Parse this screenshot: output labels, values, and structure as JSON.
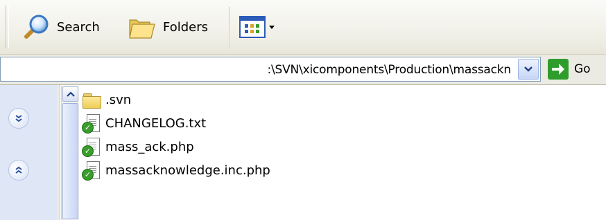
{
  "toolbar": {
    "search_label": "Search",
    "folders_label": "Folders",
    "search_icon": "search-icon",
    "folders_icon": "folders-icon",
    "views_icon": "views-icon"
  },
  "address": {
    "path": ":\\SVN\\xicomponents\\Production\\massackn",
    "go_label": "Go"
  },
  "files": [
    {
      "name": ".svn",
      "type": "folder"
    },
    {
      "name": "CHANGELOG.txt",
      "type": "file-svn-ok"
    },
    {
      "name": "mass_ack.php",
      "type": "file-svn-ok"
    },
    {
      "name": "massacknowledge.inc.php",
      "type": "file-svn-ok"
    }
  ],
  "colors": {
    "go_green": "#2f9d2c",
    "svn_check": "#3a9d2c"
  }
}
